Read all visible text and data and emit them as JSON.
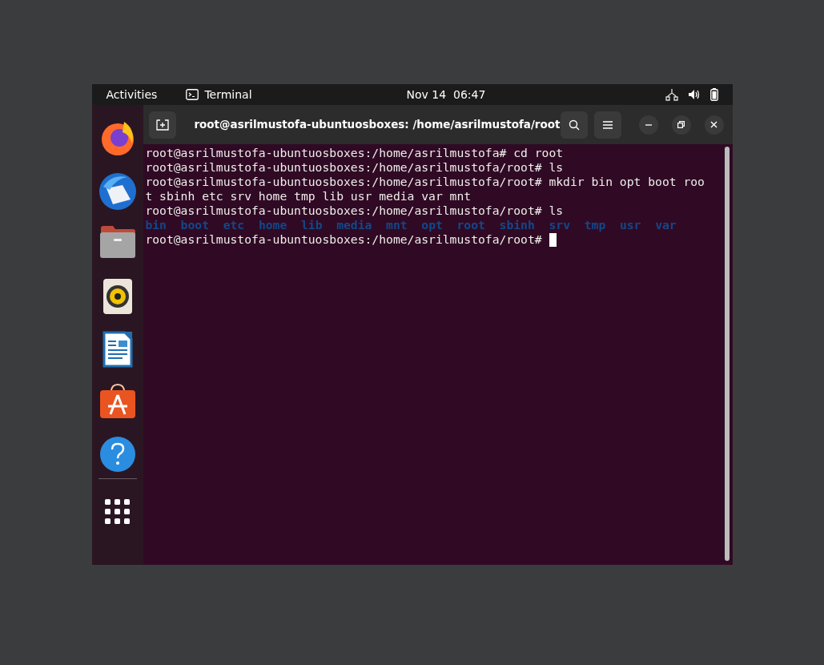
{
  "top_bar": {
    "activities": "Activities",
    "app_name": "Terminal",
    "clock": "Nov 14  06:47"
  },
  "dock": {
    "items": [
      {
        "kind": "browser"
      },
      {
        "kind": "mail"
      },
      {
        "kind": "files"
      },
      {
        "kind": "music"
      },
      {
        "kind": "writer"
      },
      {
        "kind": "store"
      },
      {
        "kind": "help"
      }
    ]
  },
  "terminal": {
    "title": "root@asrilmustofa-ubuntuosboxes: /home/asrilmustofa/root",
    "lines": [
      {
        "kind": "text",
        "text": "root@asrilmustofa-ubuntuosboxes:/home/asrilmustofa# cd root"
      },
      {
        "kind": "text",
        "text": "root@asrilmustofa-ubuntuosboxes:/home/asrilmustofa/root# ls"
      },
      {
        "kind": "text",
        "text": "root@asrilmustofa-ubuntuosboxes:/home/asrilmustofa/root# mkdir bin opt boot roo"
      },
      {
        "kind": "text",
        "text": "t sbinh etc srv home tmp lib usr media var mnt"
      },
      {
        "kind": "text",
        "text": "root@asrilmustofa-ubuntuosboxes:/home/asrilmustofa/root# ls"
      },
      {
        "kind": "listing",
        "items": [
          "bin",
          "boot",
          "etc",
          "home",
          "lib",
          "media",
          "mnt",
          "opt",
          "root",
          "sbinh",
          "srv",
          "tmp",
          "usr",
          "var"
        ]
      },
      {
        "kind": "prompt",
        "text": "root@asrilmustofa-ubuntuosboxes:/home/asrilmustofa/root#",
        "cursor": true
      }
    ]
  }
}
